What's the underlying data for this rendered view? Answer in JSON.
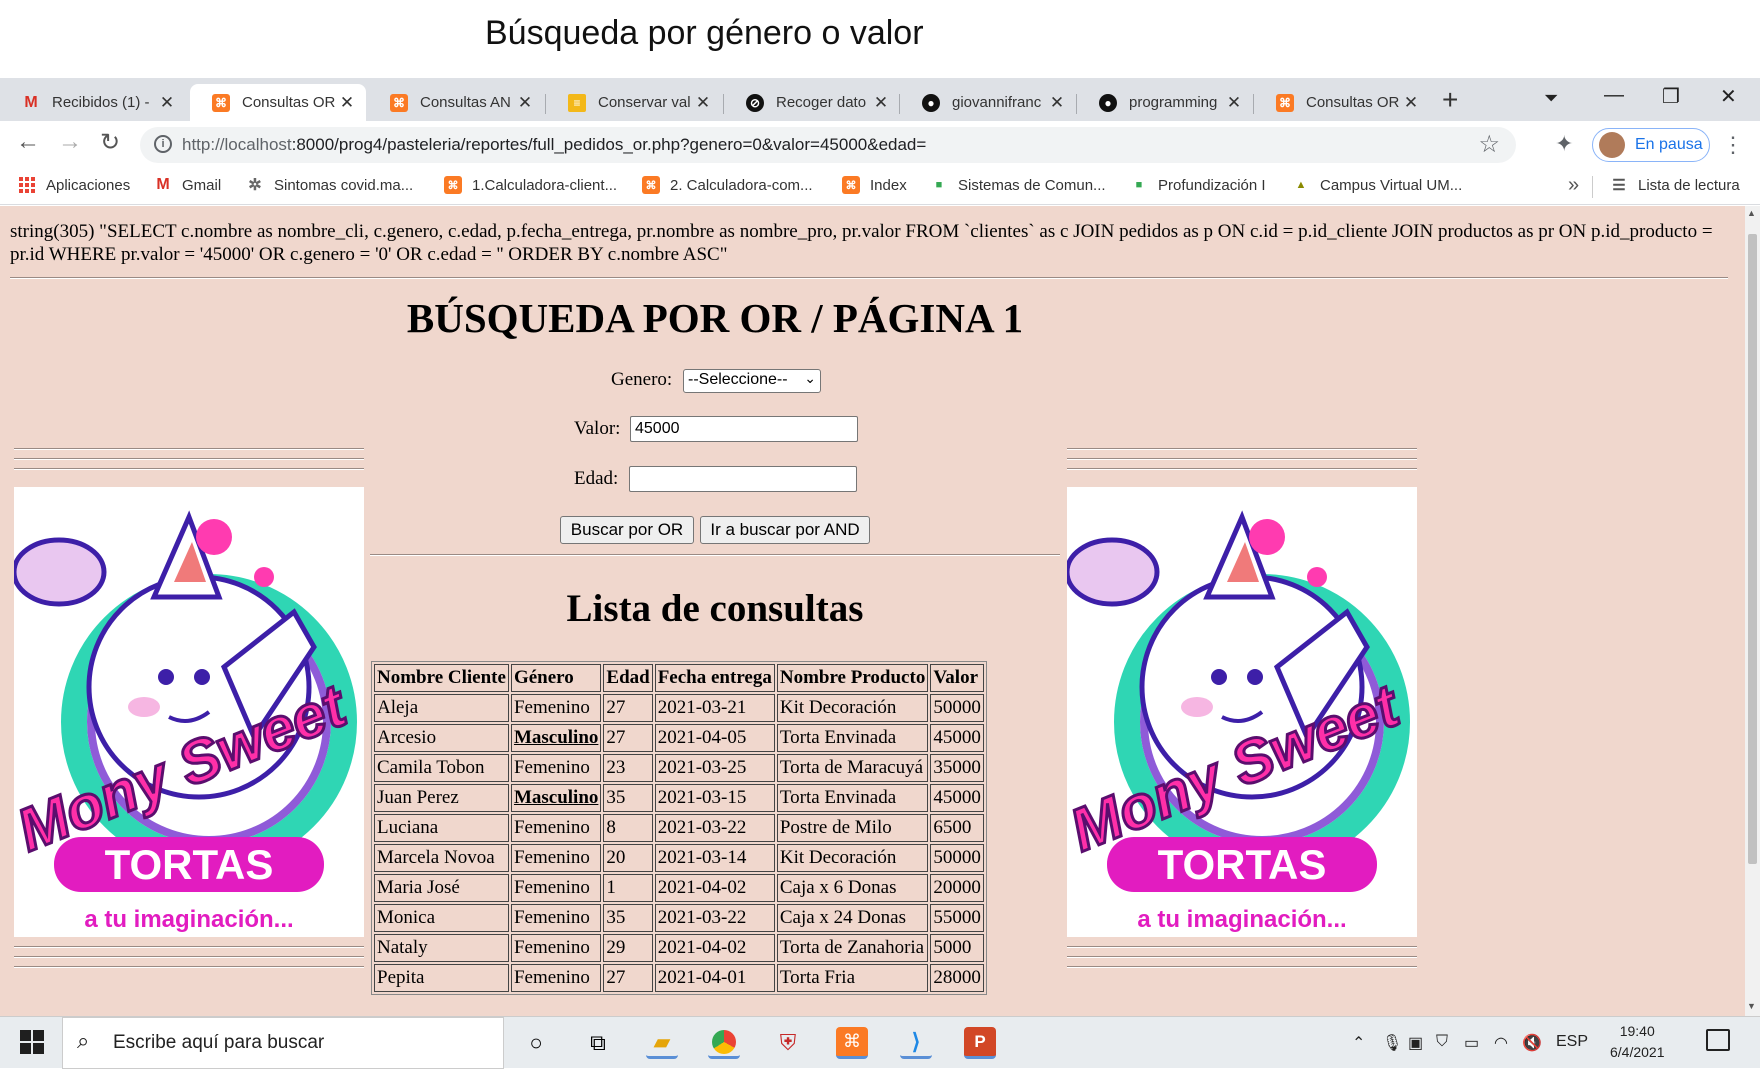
{
  "caption": "Búsqueda por género o valor",
  "browser": {
    "tabs": [
      {
        "title": "Recibidos (1) -",
        "icon": "gmail-icon",
        "active": false
      },
      {
        "title": "Consultas OR",
        "icon": "xampp-icon",
        "active": true
      },
      {
        "title": "Consultas AN",
        "icon": "xampp-icon",
        "active": false
      },
      {
        "title": "Conservar val",
        "icon": "yellow-doc-icon",
        "active": false
      },
      {
        "title": "Recoger dato",
        "icon": "circle-icon",
        "active": false
      },
      {
        "title": "giovannifranc",
        "icon": "github-icon",
        "active": false
      },
      {
        "title": "programming",
        "icon": "github-icon",
        "active": false
      },
      {
        "title": "Consultas OR",
        "icon": "xampp-icon",
        "active": false
      }
    ],
    "url_host": "http://localhost",
    "url_rest": ":8000/prog4/pasteleria/reportes/full_pedidos_or.php?genero=0&valor=45000&edad=",
    "profile_label": "En pausa",
    "bookmarks": [
      {
        "label": "Aplicaciones",
        "icon": "apps-grid-icon"
      },
      {
        "label": "Gmail",
        "icon": "gmail-icon"
      },
      {
        "label": "Sintomas covid.ma...",
        "icon": "gear-icon"
      },
      {
        "label": "1.Calculadora-client...",
        "icon": "xampp-icon"
      },
      {
        "label": "2. Calculadora-com...",
        "icon": "xampp-icon"
      },
      {
        "label": "Index",
        "icon": "xampp-icon"
      },
      {
        "label": "Sistemas de Comun...",
        "icon": "meet-icon"
      },
      {
        "label": "Profundización I",
        "icon": "meet-icon"
      },
      {
        "label": "Campus Virtual UM...",
        "icon": "campus-icon"
      }
    ],
    "reading_list": "Lista de lectura"
  },
  "page": {
    "debug_sql": "string(305) \"SELECT c.nombre as nombre_cli, c.genero, c.edad, p.fecha_entrega, pr.nombre as nombre_pro, pr.valor FROM `clientes` as c JOIN pedidos as p ON c.id = p.id_cliente JOIN productos as pr ON p.id_producto = pr.id WHERE pr.valor = '45000' OR c.genero = '0' OR c.edad = '' ORDER BY c.nombre ASC\"",
    "title": "BÚSQUEDA POR OR / PÁGINA 1",
    "form": {
      "genero_label": "Genero:",
      "genero_value": "--Seleccione--",
      "valor_label": "Valor:",
      "valor_value": "45000",
      "edad_label": "Edad:",
      "edad_value": "",
      "btn_or": "Buscar por OR",
      "btn_and": "Ir a buscar por AND"
    },
    "list_title": "Lista de consultas",
    "table": {
      "headers": [
        "Nombre Cliente",
        "Género",
        "Edad",
        "Fecha entrega",
        "Nombre Producto",
        "Valor"
      ],
      "rows": [
        [
          "Aleja",
          "Femenino",
          "27",
          "2021-03-21",
          "Kit Decoración",
          "50000"
        ],
        [
          "Arcesio",
          "Masculino",
          "27",
          "2021-04-05",
          "Torta Envinada",
          "45000"
        ],
        [
          "Camila Tobon",
          "Femenino",
          "23",
          "2021-03-25",
          "Torta de Maracuyá",
          "35000"
        ],
        [
          "Juan Perez",
          "Masculino",
          "35",
          "2021-03-15",
          "Torta Envinada",
          "45000"
        ],
        [
          "Luciana",
          "Femenino",
          "8",
          "2021-03-22",
          "Postre de Milo",
          "6500"
        ],
        [
          "Marcela Novoa",
          "Femenino",
          "20",
          "2021-03-14",
          "Kit Decoración",
          "50000"
        ],
        [
          "Maria José",
          "Femenino",
          "1",
          "2021-04-02",
          "Caja x 6 Donas",
          "20000"
        ],
        [
          "Monica",
          "Femenino",
          "35",
          "2021-03-22",
          "Caja x 24 Donas",
          "55000"
        ],
        [
          "Nataly",
          "Femenino",
          "29",
          "2021-04-02",
          "Torta de Zanahoria",
          "5000"
        ],
        [
          "Pepita",
          "Femenino",
          "27",
          "2021-04-01",
          "Torta Fria",
          "28000"
        ]
      ]
    },
    "logo": {
      "brand": "Mony Sweet",
      "product": "TORTAS",
      "tagline": "a tu imaginación..."
    }
  },
  "taskbar": {
    "search_placeholder": "Escribe aquí para buscar",
    "language": "ESP",
    "time": "19:40",
    "date": "6/4/2021"
  }
}
